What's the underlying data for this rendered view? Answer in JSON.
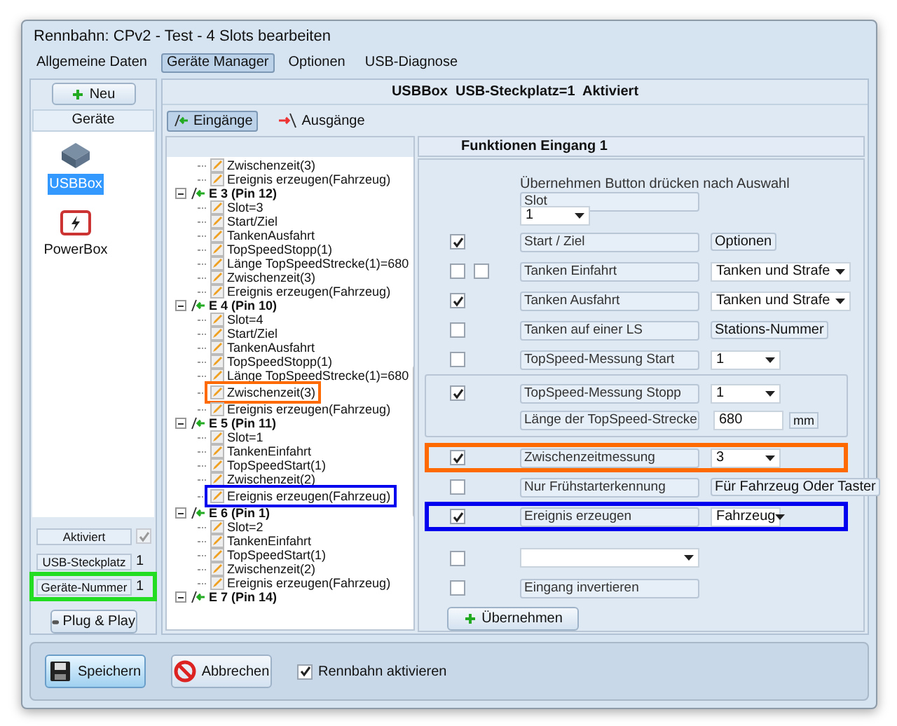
{
  "window": {
    "title": "Rennbahn: CPv2 - Test - 4 Slots bearbeiten"
  },
  "menu_tabs": [
    {
      "label": "Allgemeine Daten",
      "selected": false
    },
    {
      "label": "Geräte Manager",
      "selected": true
    },
    {
      "label": "Optionen",
      "selected": false
    },
    {
      "label": "USB-Diagnose",
      "selected": false
    }
  ],
  "devices_panel": {
    "new_button": "Neu",
    "header": "Geräte",
    "devices": [
      {
        "label": "USBBox",
        "kind": "usb",
        "selected": true
      },
      {
        "label": "PowerBox",
        "kind": "power",
        "selected": false
      }
    ],
    "properties": [
      {
        "label": "Aktiviert",
        "kind": "check",
        "checked": true
      },
      {
        "label": "USB-Steckplatz",
        "kind": "value",
        "value": "1"
      },
      {
        "label": "Geräte-Nummer",
        "kind": "value",
        "value": "1",
        "color": "#22dd22"
      }
    ],
    "plug_button": "Plug & Play"
  },
  "device_header": "USBBox  USB-Steckplatz=1  Aktiviert",
  "io_tabs": [
    {
      "label": "Eingänge",
      "kind": "in",
      "selected": true
    },
    {
      "label": "Ausgänge",
      "kind": "out",
      "selected": false
    }
  ],
  "tree": [
    {
      "kind": "leaf",
      "label": "Zwischenzeit(3)"
    },
    {
      "kind": "leaf",
      "label": "Ereignis erzeugen(Fahrzeug)"
    },
    {
      "kind": "group",
      "label": "E 3 (Pin 12)",
      "expanded": true,
      "children": [
        {
          "kind": "leaf",
          "label": "Slot=3"
        },
        {
          "kind": "leaf",
          "label": "Start/Ziel"
        },
        {
          "kind": "leaf",
          "label": "TankenAusfahrt"
        },
        {
          "kind": "leaf",
          "label": "TopSpeedStopp(1)"
        },
        {
          "kind": "leaf",
          "label": "Länge TopSpeedStrecke(1)=680"
        },
        {
          "kind": "leaf",
          "label": "Zwischenzeit(3)"
        },
        {
          "kind": "leaf",
          "label": "Ereignis erzeugen(Fahrzeug)"
        }
      ]
    },
    {
      "kind": "group",
      "label": "E 4 (Pin 10)",
      "expanded": true,
      "children": [
        {
          "kind": "leaf",
          "label": "Slot=4"
        },
        {
          "kind": "leaf",
          "label": "Start/Ziel"
        },
        {
          "kind": "leaf",
          "label": "TankenAusfahrt"
        },
        {
          "kind": "leaf",
          "label": "TopSpeedStopp(1)"
        },
        {
          "kind": "leaf",
          "label": "Länge TopSpeedStrecke(1)=680"
        },
        {
          "kind": "leaf",
          "label": "Zwischenzeit(3)",
          "color": "#ff6a00"
        },
        {
          "kind": "leaf",
          "label": "Ereignis erzeugen(Fahrzeug)"
        }
      ]
    },
    {
      "kind": "group",
      "label": "E 5 (Pin 11)",
      "expanded": true,
      "children": [
        {
          "kind": "leaf",
          "label": "Slot=1"
        },
        {
          "kind": "leaf",
          "label": "TankenEinfahrt"
        },
        {
          "kind": "leaf",
          "label": "TopSpeedStart(1)"
        },
        {
          "kind": "leaf",
          "label": "Zwischenzeit(2)"
        },
        {
          "kind": "leaf",
          "label": "Ereignis erzeugen(Fahrzeug)",
          "color": "#0000ee"
        }
      ]
    },
    {
      "kind": "group",
      "label": "E 6 (Pin 1)",
      "expanded": true,
      "children": [
        {
          "kind": "leaf",
          "label": "Slot=2"
        },
        {
          "kind": "leaf",
          "label": "TankenEinfahrt"
        },
        {
          "kind": "leaf",
          "label": "TopSpeedStart(1)"
        },
        {
          "kind": "leaf",
          "label": "Zwischenzeit(2)"
        },
        {
          "kind": "leaf",
          "label": "Ereignis erzeugen(Fahrzeug)"
        }
      ]
    },
    {
      "kind": "group",
      "label": "E 7 (Pin 14)",
      "expanded": true
    }
  ],
  "form": {
    "title": "Funktionen Eingang 1",
    "rows": [
      {
        "kind": "text",
        "text": "Übernehmen Button drücken nach Auswahl"
      },
      {
        "kind": "label",
        "text": "Slot"
      },
      {
        "kind": "select",
        "value": "1"
      },
      {
        "kind": "option",
        "checks": [
          true
        ],
        "label": "Start / Ziel",
        "side": {
          "kind": "caption",
          "text": "Optionen"
        }
      },
      {
        "kind": "option",
        "checks": [
          false,
          false
        ],
        "label": "Tanken Einfahrt",
        "side": {
          "kind": "select",
          "value": "Tanken und Strafe"
        }
      },
      {
        "kind": "option",
        "checks": [
          true
        ],
        "label": "Tanken Ausfahrt",
        "side": {
          "kind": "select",
          "value": "Tanken und Strafe"
        }
      },
      {
        "kind": "option",
        "checks": [
          false
        ],
        "label": "Tanken auf einer LS",
        "side": {
          "kind": "caption",
          "text": "Stations-Nummer"
        }
      },
      {
        "kind": "option",
        "checks": [
          false
        ],
        "label": "TopSpeed-Messung Start",
        "side": {
          "kind": "small_select",
          "value": "1"
        }
      },
      {
        "kind": "group",
        "rows": [
          {
            "kind": "option",
            "checks": [
              true
            ],
            "label": "TopSpeed-Messung Stopp",
            "side": {
              "kind": "small_select",
              "value": "1"
            }
          },
          {
            "kind": "length",
            "label": "Länge der TopSpeed-Strecke",
            "value": "680",
            "unit": "mm"
          }
        ]
      },
      {
        "kind": "option",
        "checks": [
          true
        ],
        "label": "Zwischenzeitmessung",
        "side": {
          "kind": "small_select",
          "value": "3"
        },
        "color": "#ff6a00"
      },
      {
        "kind": "option",
        "checks": [
          false
        ],
        "label": "Nur Frühstarterkennung",
        "side": {
          "kind": "caption",
          "text": "Für Fahrzeug Oder Taster"
        }
      },
      {
        "kind": "option",
        "checks": [
          true
        ],
        "label": "Ereignis erzeugen",
        "side": {
          "kind": "small_select",
          "value": "Fahrzeug"
        },
        "color": "#0000ee"
      },
      {
        "kind": "blank_select",
        "checks": [
          false
        ]
      },
      {
        "kind": "option",
        "checks": [
          false
        ],
        "label": "Eingang invertieren"
      },
      {
        "kind": "button",
        "text": "Übernehmen"
      }
    ]
  },
  "bottom": {
    "save": "Speichern",
    "cancel": "Abbrechen",
    "track_active": {
      "label": "Rennbahn aktivieren",
      "checked": true
    }
  }
}
